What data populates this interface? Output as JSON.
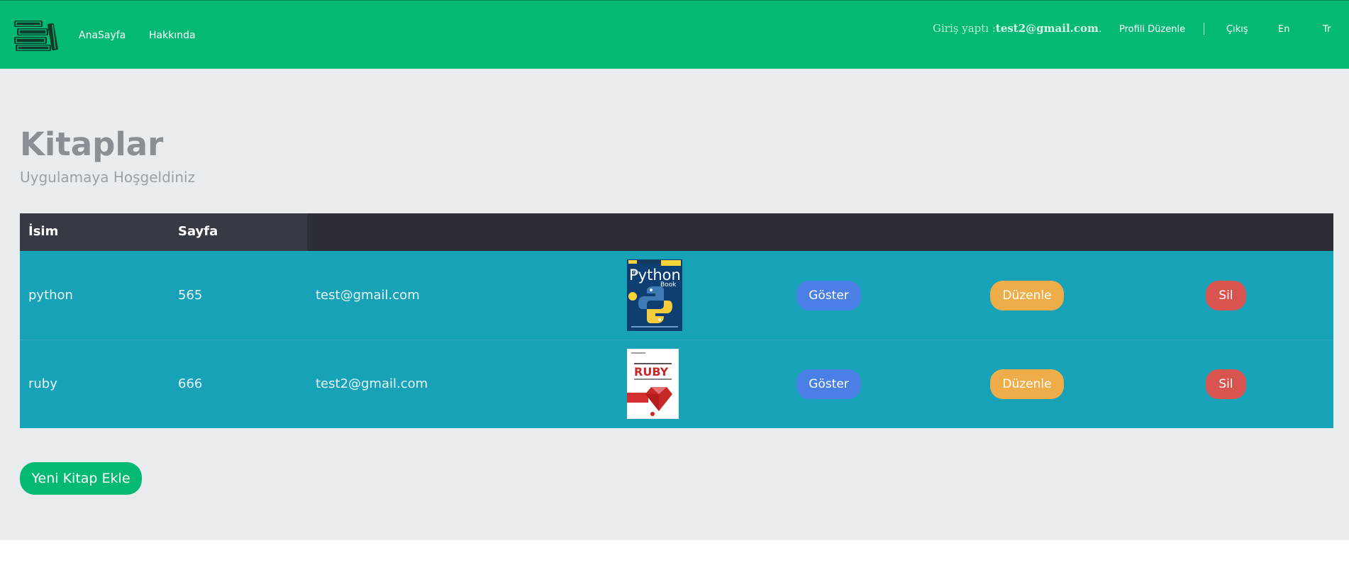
{
  "nav": {
    "home": "AnaSayfa",
    "about": "Hakkında",
    "login_prefix": "Giriş yaptı :",
    "login_user": "test2@gmail.com",
    "login_suffix": ".",
    "edit_profile": "Profili Düzenle",
    "logout": "Çıkış",
    "lang_en": "En",
    "lang_tr": "Tr"
  },
  "page": {
    "title": "Kitaplar",
    "subtitle": "Uygulamaya Hoşgeldiniz"
  },
  "table": {
    "headers": [
      "İsim",
      "Sayfa"
    ],
    "rows": [
      {
        "name": "python",
        "pages": "565",
        "owner": "test@gmail.com",
        "cover": "python-book-cover",
        "show": "Göster",
        "edit": "Düzenle",
        "delete": "Sil"
      },
      {
        "name": "ruby",
        "pages": "666",
        "owner": "test2@gmail.com",
        "cover": "ruby-book-cover",
        "show": "Göster",
        "edit": "Düzenle",
        "delete": "Sil"
      }
    ]
  },
  "cover_texts": {
    "python_title": "Python",
    "python_the": "The",
    "python_book": "Book",
    "ruby_title": "RUBY"
  },
  "actions": {
    "add_book": "Yeni Kitap Ekle"
  },
  "colors": {
    "navbar": "#03b974",
    "page_bg": "#e8ecef",
    "table_header": "#2b2f35",
    "table_row": "#17a2b8",
    "show_button": "#4a7fe6",
    "edit_button": "#efad49",
    "delete_button": "#d9534f"
  },
  "icons": {
    "logo": "books-stack-icon"
  }
}
